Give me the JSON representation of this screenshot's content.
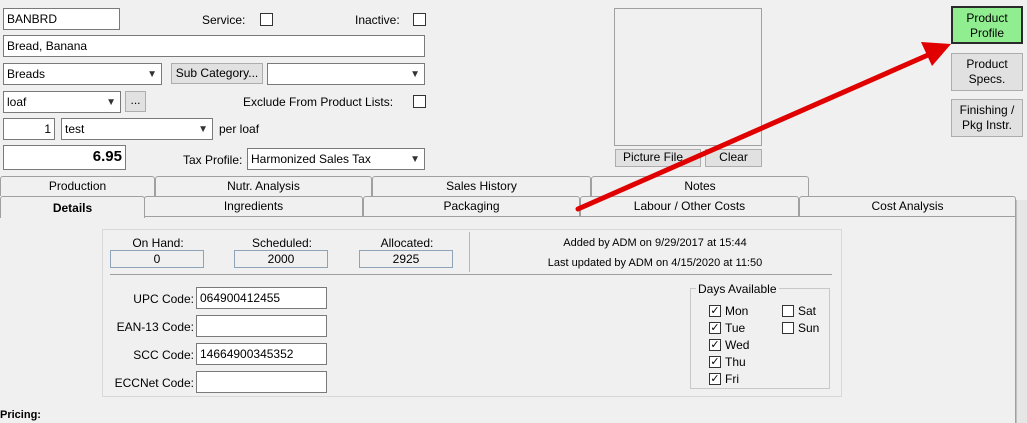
{
  "header": {
    "code": "BANBRD",
    "service_label": "Service:",
    "inactive_label": "Inactive:",
    "description": "Bread, Banana",
    "category": "Breads",
    "sub_category_btn": "Sub Category...",
    "sub_category_value": "",
    "unit": "loaf",
    "ellipsis_btn": "...",
    "exclude_label": "Exclude From Product Lists:",
    "qty": "1",
    "pack": "test",
    "per_label": "per loaf",
    "price": "6.95",
    "tax_label": "Tax Profile:",
    "tax_value": "Harmonized Sales Tax",
    "picture_btn": "Picture File...",
    "clear_btn": "Clear"
  },
  "side_buttons": {
    "product_profile": [
      "Product",
      "Profile"
    ],
    "product_specs": [
      "Product",
      "Specs."
    ],
    "finishing": [
      "Finishing /",
      "Pkg Instr."
    ]
  },
  "tabs_row1": [
    "Production",
    "Nutr. Analysis",
    "Sales History",
    "Notes"
  ],
  "tabs_row2": [
    "Details",
    "Ingredients",
    "Packaging",
    "Labour / Other Costs",
    "Cost Analysis"
  ],
  "details": {
    "on_hand_label": "On Hand:",
    "on_hand": "0",
    "scheduled_label": "Scheduled:",
    "scheduled": "2000",
    "allocated_label": "Allocated:",
    "allocated": "2925",
    "added_by": "Added by ADM on 9/29/2017 at 15:44",
    "updated_by": "Last updated by ADM on 4/15/2020 at 11:50",
    "upc_label": "UPC Code:",
    "upc": "064900412455",
    "ean_label": "EAN-13 Code:",
    "ean": "",
    "scc_label": "SCC Code:",
    "scc": "14664900345352",
    "ecc_label": "ECCNet Code:",
    "ecc": "",
    "days_title": "Days Available",
    "days": [
      {
        "label": "Mon",
        "checked": true
      },
      {
        "label": "Tue",
        "checked": true
      },
      {
        "label": "Wed",
        "checked": true
      },
      {
        "label": "Thu",
        "checked": true
      },
      {
        "label": "Fri",
        "checked": true
      },
      {
        "label": "Sat",
        "checked": false
      },
      {
        "label": "Sun",
        "checked": false
      }
    ],
    "pricing_label": "Pricing:"
  },
  "colors": {
    "active_button": "#90ee90",
    "arrow": "#e00000"
  }
}
